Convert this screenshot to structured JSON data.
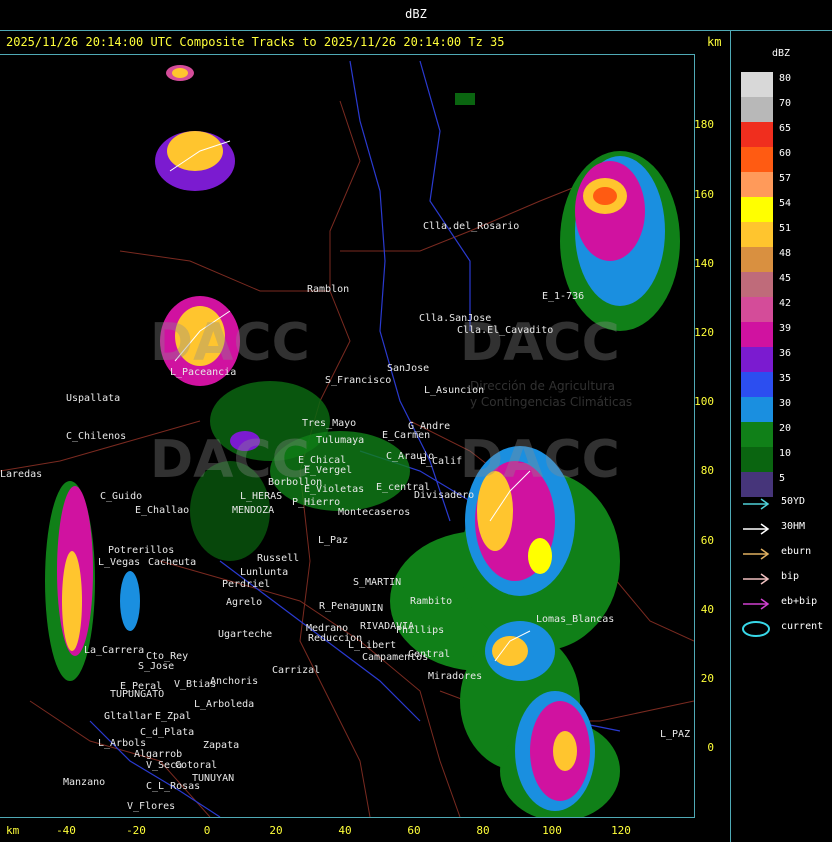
{
  "top_title": "dBZ",
  "header": "2025/11/26 20:14:00 UTC Composite Tracks to 2025/11/26 20:14:00 Tz 35",
  "km_unit": "km",
  "y_axis": [
    "180",
    "160",
    "140",
    "120",
    "100",
    "80",
    "60",
    "40",
    "20",
    "0"
  ],
  "x_axis": [
    "-40",
    "-20",
    "0",
    "20",
    "40",
    "60",
    "80",
    "100",
    "120"
  ],
  "legend": {
    "title": "dBZ",
    "entries": [
      {
        "value": "80",
        "color": "#d8d8d8"
      },
      {
        "value": "70",
        "color": "#b8b8b8"
      },
      {
        "value": "65",
        "color": "#f02e1e"
      },
      {
        "value": "60",
        "color": "#ff5b12"
      },
      {
        "value": "57",
        "color": "#ff9a5a"
      },
      {
        "value": "54",
        "color": "#ffff00"
      },
      {
        "value": "51",
        "color": "#ffc52e"
      },
      {
        "value": "48",
        "color": "#d99040"
      },
      {
        "value": "45",
        "color": "#bf6b7a"
      },
      {
        "value": "42",
        "color": "#d44c99"
      },
      {
        "value": "39",
        "color": "#d012a0"
      },
      {
        "value": "36",
        "color": "#7b1bd0"
      },
      {
        "value": "35",
        "color": "#2c4ef0"
      },
      {
        "value": "30",
        "color": "#1a8fe0"
      },
      {
        "value": "20",
        "color": "#108018"
      },
      {
        "value": "10",
        "color": "#0a6510"
      },
      {
        "value": "5",
        "color": "#46357a"
      }
    ]
  },
  "tracks": [
    {
      "label": "50YD",
      "color": "#4fd0d8",
      "icon": "arrow-right-icon"
    },
    {
      "label": "30HM",
      "color": "#ffffff",
      "icon": "arrow-right-icon"
    },
    {
      "label": "eburn",
      "color": "#e0b060",
      "icon": "arrow-right-icon"
    },
    {
      "label": "bip",
      "color": "#f0c0c0",
      "icon": "arrow-right-icon"
    },
    {
      "label": "eb+bip",
      "color": "#d040d0",
      "icon": "arrow-right-icon"
    },
    {
      "label": "current",
      "color": "#38d8e8",
      "icon": "ellipse-icon"
    }
  ],
  "watermarks": {
    "logo_text": "DACC",
    "subtitle_1": "Dirección de Agricultura",
    "subtitle_2": "y Contingencias Climáticas"
  },
  "places": [
    "Clla.del_Rosario",
    "Ramblon",
    "Clla.SanJose",
    "Clla.El_Cavadito",
    "E_1-736",
    "Uspallata",
    "L_Paceancia",
    "S_Francisco",
    "SanJose",
    "L_Asuncion",
    "C_Chilenos",
    "Tres_Mayo",
    "G_Andre",
    "Tulumaya",
    "E_Carmen",
    "E_Chical",
    "E_Vergel",
    "C_Araujo",
    "E_Calif",
    "Borbollon",
    "E_Violetas",
    "E_central",
    "Divisadero",
    "C_Guido",
    "L_HERAS",
    "P_Hierro",
    "Montecaseros",
    "E_Challao",
    "MENDOZA",
    "L_Paz",
    "Potrerillos",
    "Cacheuta",
    "L_Vegas",
    "Russell",
    "Lunlunta",
    "S_MARTIN",
    "Perdriel",
    "Agrelo",
    "R_Pena",
    "JUNIN",
    "Rambito",
    "Ugarteche",
    "Medrano",
    "RIVADAVIA",
    "Phillips",
    "Lomas_Blancas",
    "Reduccion",
    "L_Libert",
    "Campamentos",
    "Central",
    "La_Carrera",
    "Cto_Rey",
    "S_Jose",
    "Anchoris",
    "Carrizal",
    "E_Peral",
    "V_Btias",
    "TUPUNGATO",
    "L_Arboleda",
    "Miradores",
    "Gltallar",
    "E_Zpal",
    "L_Arbols",
    "C_d_Plata",
    "Zapata",
    "V_Seca",
    "Algarrob",
    "Cotoral",
    "TUNUYAN",
    "Manzano",
    "C_L_Rosas",
    "V_Flores",
    "L_PAZ",
    "Laredas"
  ]
}
